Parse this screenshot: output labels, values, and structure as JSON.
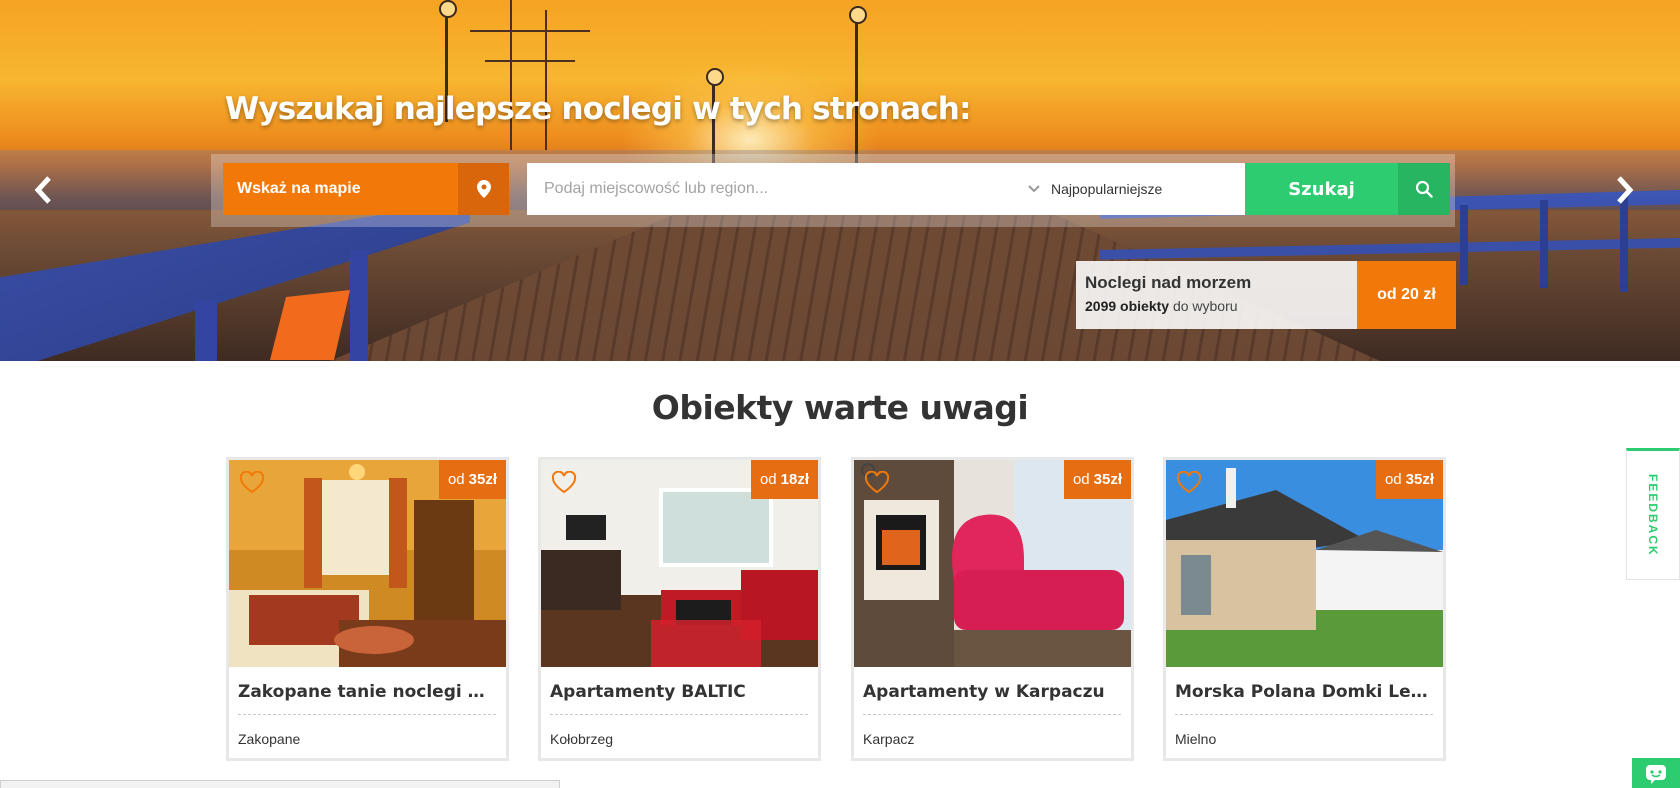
{
  "hero": {
    "title": "Wyszukaj najlepsze noclegi w tych stronach:",
    "map_button": "Wskaż na mapie",
    "search_placeholder": "Podaj miejscowość lub region...",
    "sort_selected": "Najpopularniejsze",
    "search_button": "Szukaj",
    "promo": {
      "title": "Noclegi nad morzem",
      "count": "2099 obiekty",
      "count_suffix": "do wyboru",
      "price": "od 20 zł"
    }
  },
  "section": {
    "title": "Obiekty warte uwagi"
  },
  "cards": [
    {
      "price_prefix": "od",
      "price": "35zł",
      "title": "Zakopane tanie noclegi Will...",
      "location": "Zakopane"
    },
    {
      "price_prefix": "od",
      "price": "18zł",
      "title": "Apartamenty BALTIC",
      "location": "Kołobrzeg"
    },
    {
      "price_prefix": "od",
      "price": "35zł",
      "title": "Apartamenty w Karpaczu",
      "location": "Karpacz"
    },
    {
      "price_prefix": "od",
      "price": "35zł",
      "title": "Morska Polana Domki Letni...",
      "location": "Mielno"
    }
  ],
  "feedback_label": "FEEDBACK",
  "colors": {
    "orange": "#f27808",
    "green": "#2ecc71",
    "text": "#333333"
  },
  "icons": [
    "map-pin-icon",
    "chevron-down-icon",
    "search-icon",
    "arrow-left-icon",
    "arrow-right-icon",
    "heart-icon",
    "chat-icon"
  ]
}
